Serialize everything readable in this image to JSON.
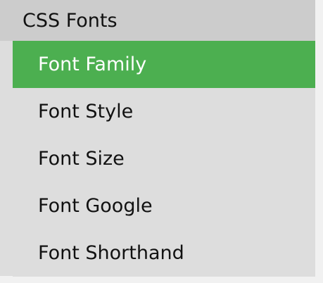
{
  "menu": {
    "title": "CSS Fonts",
    "active_color": "#4caf50",
    "items": [
      {
        "label": "Font Family",
        "active": true
      },
      {
        "label": "Font Style",
        "active": false
      },
      {
        "label": "Font Size",
        "active": false
      },
      {
        "label": "Font Google",
        "active": false
      },
      {
        "label": "Font Shorthand",
        "active": false
      }
    ]
  }
}
